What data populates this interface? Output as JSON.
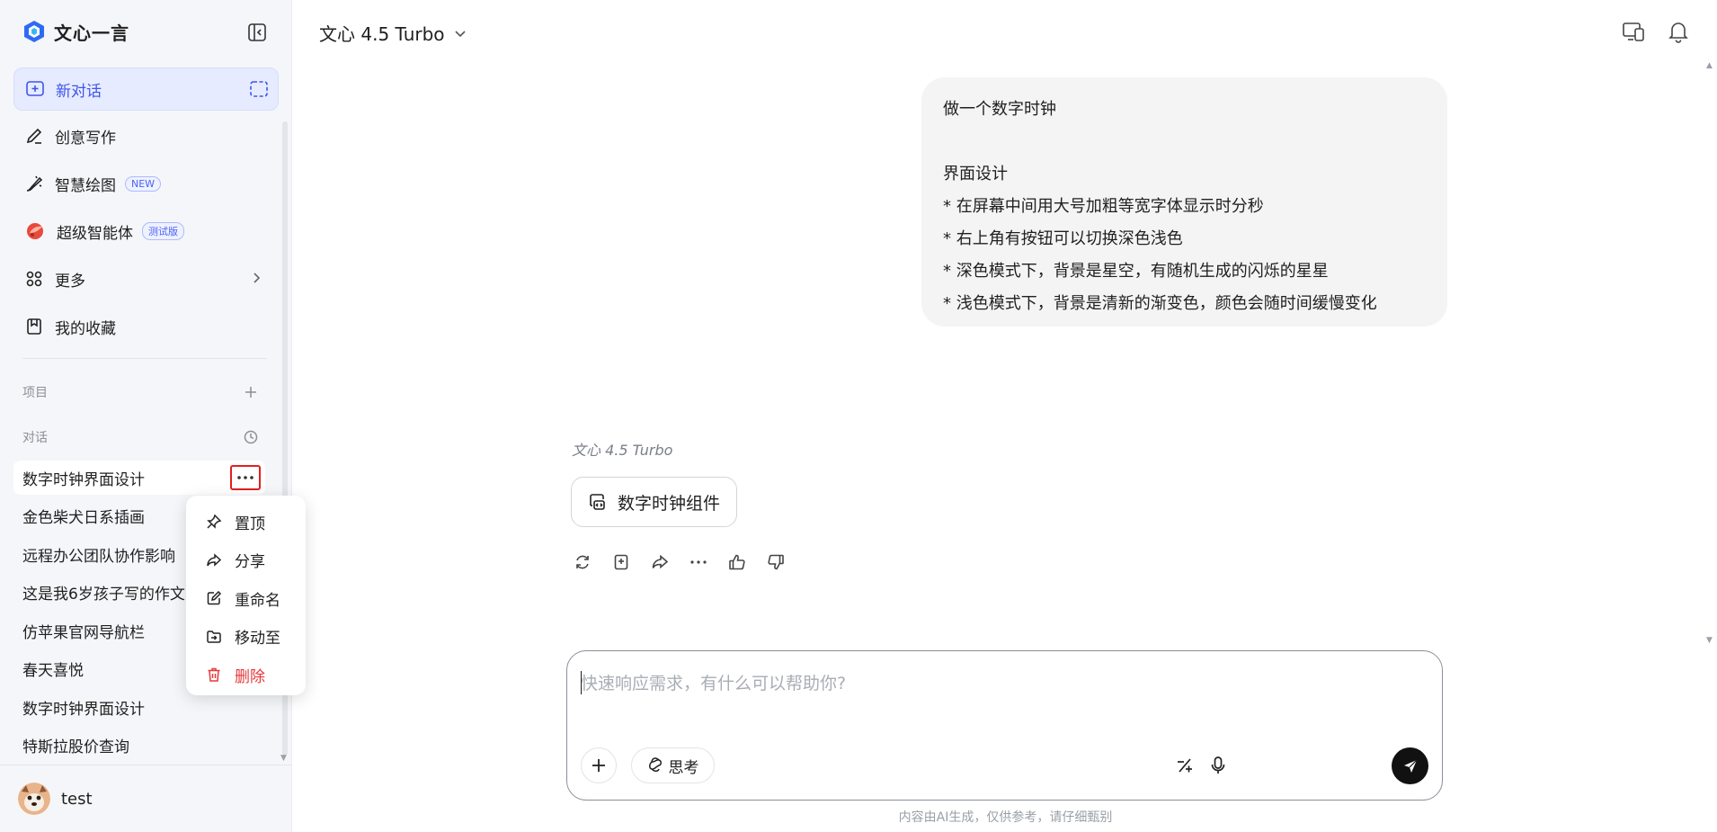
{
  "brand": {
    "name": "文心一言"
  },
  "sidebar": {
    "new_chat": "新对话",
    "items": [
      {
        "label": "创意写作"
      },
      {
        "label": "智慧绘图",
        "badge": "NEW"
      },
      {
        "label": "超级智能体",
        "badge": "测试版"
      },
      {
        "label": "更多"
      },
      {
        "label": "我的收藏"
      }
    ],
    "projects_label": "项目",
    "conversations_label": "对话",
    "conversations": [
      "数字时钟界面设计",
      "金色柴犬日系插画",
      "远程办公团队协作影响",
      "这是我6岁孩子写的作文",
      "仿苹果官网导航栏",
      "春天喜悦",
      "数字时钟界面设计",
      "特斯拉股价查询"
    ]
  },
  "context_menu": {
    "items": [
      "置顶",
      "分享",
      "重命名",
      "移动至",
      "删除"
    ]
  },
  "user": {
    "name": "test"
  },
  "topbar": {
    "model": "文心 4.5 Turbo"
  },
  "message": {
    "title": "做一个数字时钟",
    "section": "界面设计",
    "bullets": [
      "* 在屏幕中间用大号加粗等宽字体显示时分秒",
      "* 右上角有按钮可以切换深色浅色",
      "* 深色模式下，背景是星空，有随机生成的闪烁的星星",
      "* 浅色模式下，背景是清新的渐变色，颜色会随时间缓慢变化"
    ]
  },
  "reply": {
    "model": "文心 4.5 Turbo",
    "artifact": "数字时钟组件"
  },
  "composer": {
    "placeholder": "快速响应需求，有什么可以帮助你?",
    "think": "思考"
  },
  "footer": {
    "disclaimer": "内容由AI生成，仅供参考，请仔细甄别"
  },
  "colors": {
    "accent": "#3f55ea",
    "danger": "#e5383b",
    "highlight": "#e02020"
  }
}
